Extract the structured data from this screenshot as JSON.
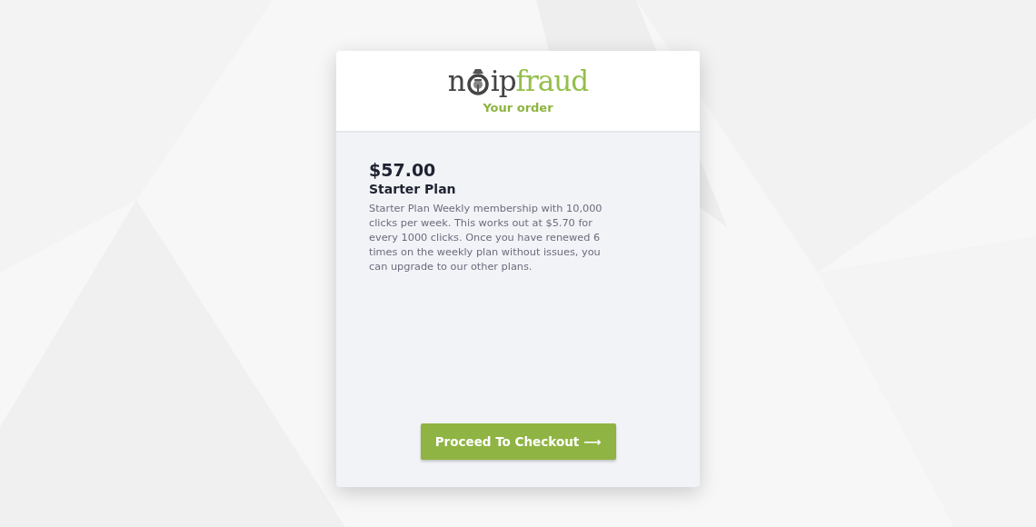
{
  "logo": {
    "dark_start": "n",
    "dark_end": "ip",
    "light": "fraud"
  },
  "header": {
    "subtitle": "Your order"
  },
  "order": {
    "price": "$57.00",
    "plan": "Starter Plan",
    "description": "Starter Plan Weekly membership with 10,000 clicks per week. This works out at $5.70 for every 1000 clicks. Once you have renewed 6 times on the weekly plan without issues, you can upgrade to our other plans."
  },
  "checkout_button": {
    "label": "Proceed To Checkout ⟶"
  }
}
